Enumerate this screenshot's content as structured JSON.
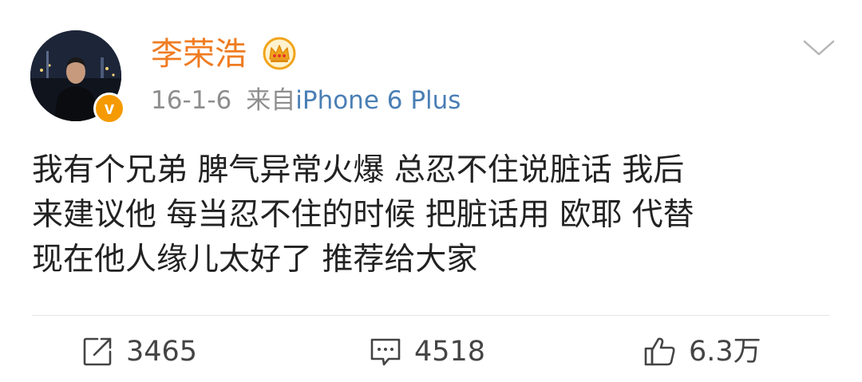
{
  "post": {
    "username": "李荣浩",
    "date": "16-1-6",
    "source_prefix": "来自",
    "source_device": "iPhone 6 Plus",
    "verified_mark": "v",
    "lines": [
      "我有个兄弟 脾气异常火爆 总忍不住说脏话 我后",
      "来建议他 每当忍不住的时候 把脏话用 欧耶 代替",
      "现在他人缘儿太好了  推荐给大家"
    ]
  },
  "actions": {
    "repost_count": "3465",
    "comment_count": "4518",
    "like_count": "6.3万"
  },
  "icons": {
    "repost": "repost-icon",
    "comment": "comment-icon",
    "like": "like-icon",
    "menu": "chevron-down-icon",
    "member": "crown-icon"
  },
  "colors": {
    "username": "#f07c22",
    "source_device": "#4a7fb5",
    "meta_gray": "#8e8e8e",
    "verified_badge": "#f59a00",
    "text": "#222222",
    "icon_gray": "#444444"
  }
}
